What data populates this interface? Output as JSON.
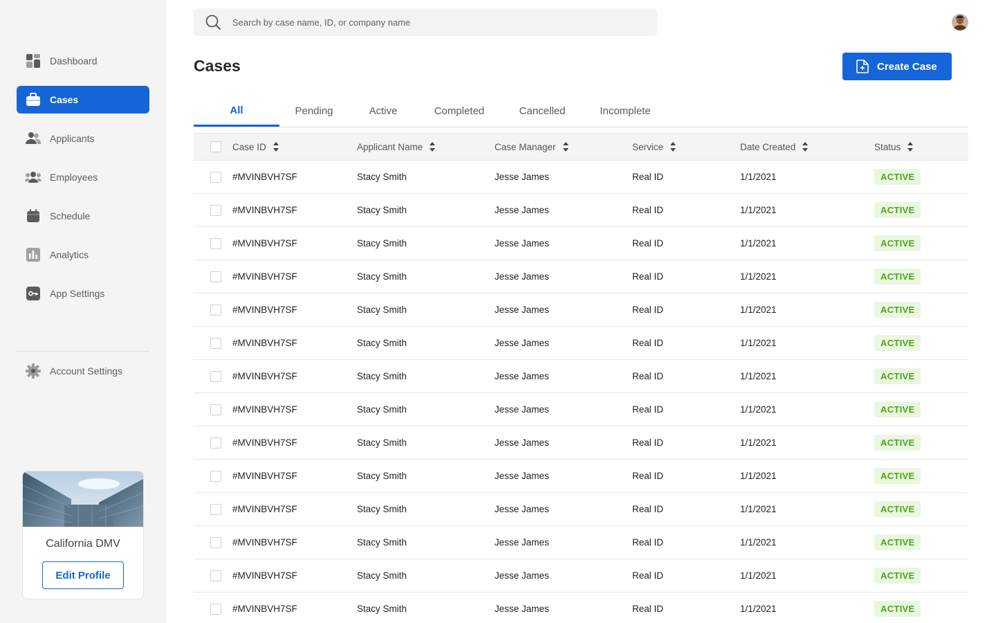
{
  "search": {
    "placeholder": "Search by case name, ID, or company name"
  },
  "sidebar": {
    "items": [
      {
        "label": "Dashboard",
        "icon": "dashboard-icon",
        "active": false
      },
      {
        "label": "Cases",
        "icon": "briefcase-icon",
        "active": true
      },
      {
        "label": "Applicants",
        "icon": "users-icon",
        "active": false
      },
      {
        "label": "Employees",
        "icon": "group-icon",
        "active": false
      },
      {
        "label": "Schedule",
        "icon": "calendar-icon",
        "active": false
      },
      {
        "label": "Analytics",
        "icon": "bar-chart-icon",
        "active": false
      },
      {
        "label": "App Settings",
        "icon": "key-icon",
        "active": false
      }
    ],
    "account": {
      "label": "Account Settings",
      "icon": "gear-icon"
    }
  },
  "profile": {
    "name": "California DMV",
    "edit_label": "Edit Profile"
  },
  "page": {
    "title": "Cases",
    "create_label": "Create Case"
  },
  "tabs": [
    "All",
    "Pending",
    "Active",
    "Completed",
    "Cancelled",
    "Incomplete"
  ],
  "active_tab": "All",
  "table": {
    "columns": [
      "Case ID",
      "Applicant Name",
      "Case Manager",
      "Service",
      "Date Created",
      "Status"
    ],
    "rows": [
      [
        "#MVINBVH7SF",
        "Stacy Smith",
        "Jesse James",
        "Real ID",
        "1/1/2021",
        "ACTIVE"
      ],
      [
        "#MVINBVH7SF",
        "Stacy Smith",
        "Jesse James",
        "Real ID",
        "1/1/2021",
        "ACTIVE"
      ],
      [
        "#MVINBVH7SF",
        "Stacy Smith",
        "Jesse James",
        "Real ID",
        "1/1/2021",
        "ACTIVE"
      ],
      [
        "#MVINBVH7SF",
        "Stacy Smith",
        "Jesse James",
        "Real ID",
        "1/1/2021",
        "ACTIVE"
      ],
      [
        "#MVINBVH7SF",
        "Stacy Smith",
        "Jesse James",
        "Real ID",
        "1/1/2021",
        "ACTIVE"
      ],
      [
        "#MVINBVH7SF",
        "Stacy Smith",
        "Jesse James",
        "Real ID",
        "1/1/2021",
        "ACTIVE"
      ],
      [
        "#MVINBVH7SF",
        "Stacy Smith",
        "Jesse James",
        "Real ID",
        "1/1/2021",
        "ACTIVE"
      ],
      [
        "#MVINBVH7SF",
        "Stacy Smith",
        "Jesse James",
        "Real ID",
        "1/1/2021",
        "ACTIVE"
      ],
      [
        "#MVINBVH7SF",
        "Stacy Smith",
        "Jesse James",
        "Real ID",
        "1/1/2021",
        "ACTIVE"
      ],
      [
        "#MVINBVH7SF",
        "Stacy Smith",
        "Jesse James",
        "Real ID",
        "1/1/2021",
        "ACTIVE"
      ],
      [
        "#MVINBVH7SF",
        "Stacy Smith",
        "Jesse James",
        "Real ID",
        "1/1/2021",
        "ACTIVE"
      ],
      [
        "#MVINBVH7SF",
        "Stacy Smith",
        "Jesse James",
        "Real ID",
        "1/1/2021",
        "ACTIVE"
      ],
      [
        "#MVINBVH7SF",
        "Stacy Smith",
        "Jesse James",
        "Real ID",
        "1/1/2021",
        "ACTIVE"
      ],
      [
        "#MVINBVH7SF",
        "Stacy Smith",
        "Jesse James",
        "Real ID",
        "1/1/2021",
        "ACTIVE"
      ]
    ]
  },
  "colors": {
    "accent": "#1565d8",
    "sidebar_bg": "#f4f4f4",
    "status_active_text": "#4aa81a",
    "status_active_bg": "#eaf6e0"
  }
}
